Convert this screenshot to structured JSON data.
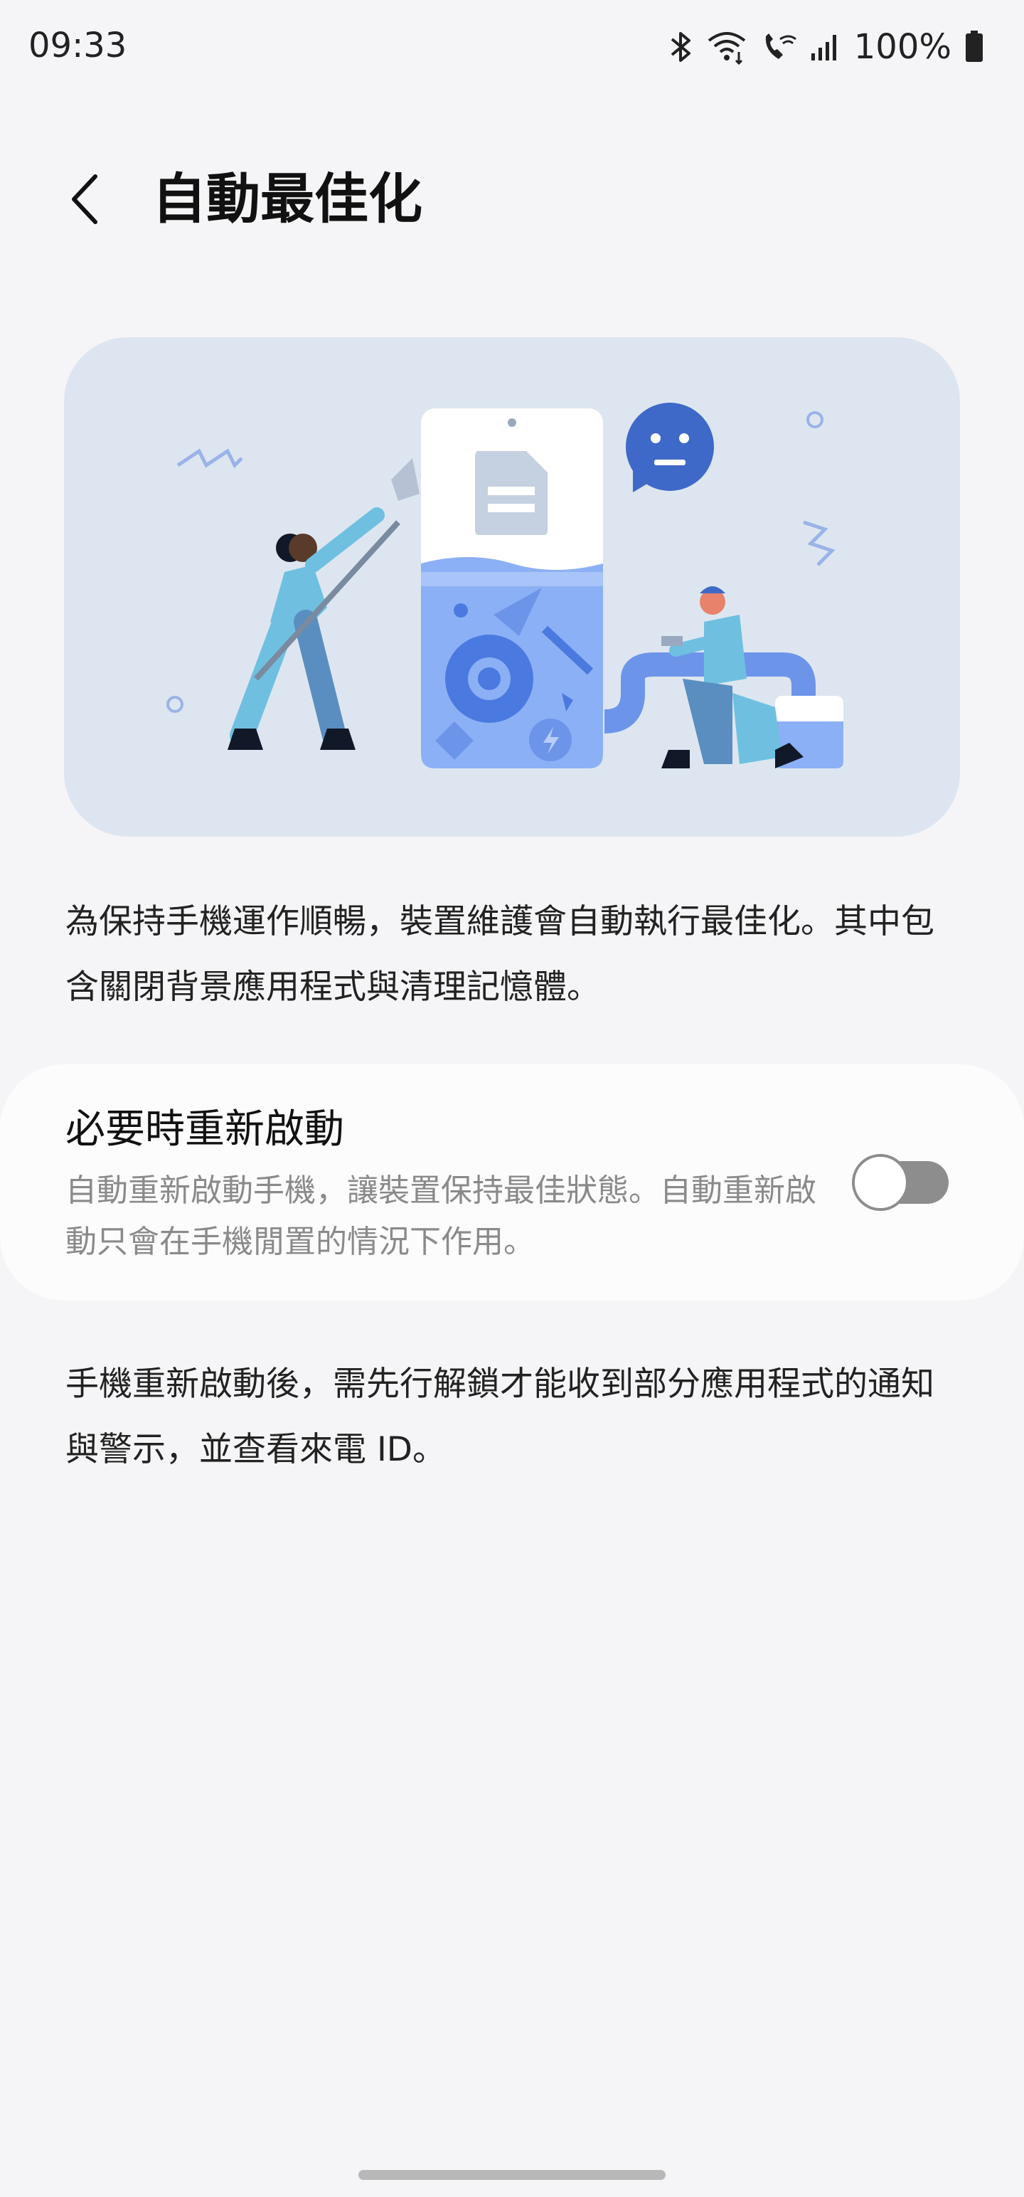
{
  "status_bar": {
    "time": "09:33",
    "battery": "100%",
    "icons": [
      "bluetooth-icon",
      "wifi-calling-icon",
      "volte-call-icon",
      "signal-icon",
      "battery-icon"
    ]
  },
  "header": {
    "title": "自動最佳化",
    "back_icon": "back-arrow-icon"
  },
  "illustration": {
    "description_icons": [
      "document-icon",
      "chat-bubble-icon",
      "gear-icon",
      "lightning-icon"
    ]
  },
  "main": {
    "description": "為保持手機運作順暢，裝置維護會自動執行最佳化。其中包含關閉背景應用程式與清理記憶體。"
  },
  "restart_setting": {
    "title": "必要時重新啟動",
    "subtitle": "自動重新啟動手機，讓裝置保持最佳狀態。自動重新啟動只會在手機閒置的情況下作用。",
    "enabled": false
  },
  "footer_note": {
    "text": "手機重新啟動後，需先行解鎖才能收到部分應用程式的通知與警示，並查看來電 ID。"
  },
  "colors": {
    "background": "#f5f5f7",
    "illustration_bg": "#dde6f0",
    "toggle_off": "#8d8d8d",
    "accent_blue": "#4a7ae0"
  }
}
